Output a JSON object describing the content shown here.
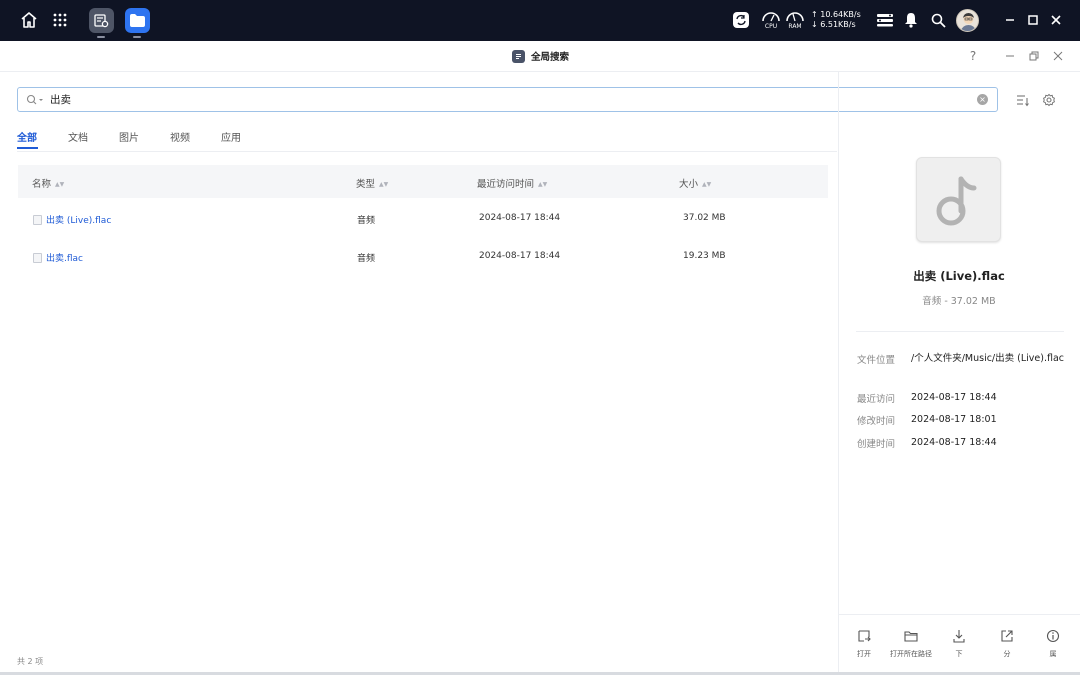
{
  "taskbar": {
    "net_up": "↑ 10.64KB/s",
    "net_down": "↓ 6.51KB/s",
    "cpu_label": "CPU",
    "ram_label": "RAM"
  },
  "window": {
    "title": "全局搜索",
    "help": "?"
  },
  "search": {
    "value": "出卖"
  },
  "tabs": [
    {
      "label": "全部",
      "active": true
    },
    {
      "label": "文档"
    },
    {
      "label": "图片"
    },
    {
      "label": "视频"
    },
    {
      "label": "应用"
    }
  ],
  "table": {
    "headers": {
      "name": "名称",
      "type": "类型",
      "time": "最近访问时间",
      "size": "大小"
    },
    "rows": [
      {
        "name_main": "出卖",
        "name_rest": " (Live).flac",
        "type": "音频",
        "time": "2024-08-17 18:44",
        "size": "37.02 MB"
      },
      {
        "name_main": "出卖",
        "name_rest": ".flac",
        "type": "音频",
        "time": "2024-08-17 18:44",
        "size": "19.23 MB"
      }
    ]
  },
  "detail": {
    "title": "出卖 (Live).flac",
    "subtitle": "音频 - 37.02 MB",
    "location_label": "文件位置",
    "location_value": "/个人文件夹/Music/出卖 (Live).flac",
    "accessed_label": "最近访问",
    "accessed_value": "2024-08-17 18:44",
    "modified_label": "修改时间",
    "modified_value": "2024-08-17 18:01",
    "created_label": "创建时间",
    "created_value": "2024-08-17 18:44"
  },
  "actions": {
    "open": "打开",
    "open_location": "打开所在路径",
    "download": "下",
    "share": "分",
    "info": "属"
  },
  "footer": {
    "count": "共 2 项"
  },
  "colors": {
    "accent": "#1f5bd6",
    "topbar": "#0f1424"
  }
}
